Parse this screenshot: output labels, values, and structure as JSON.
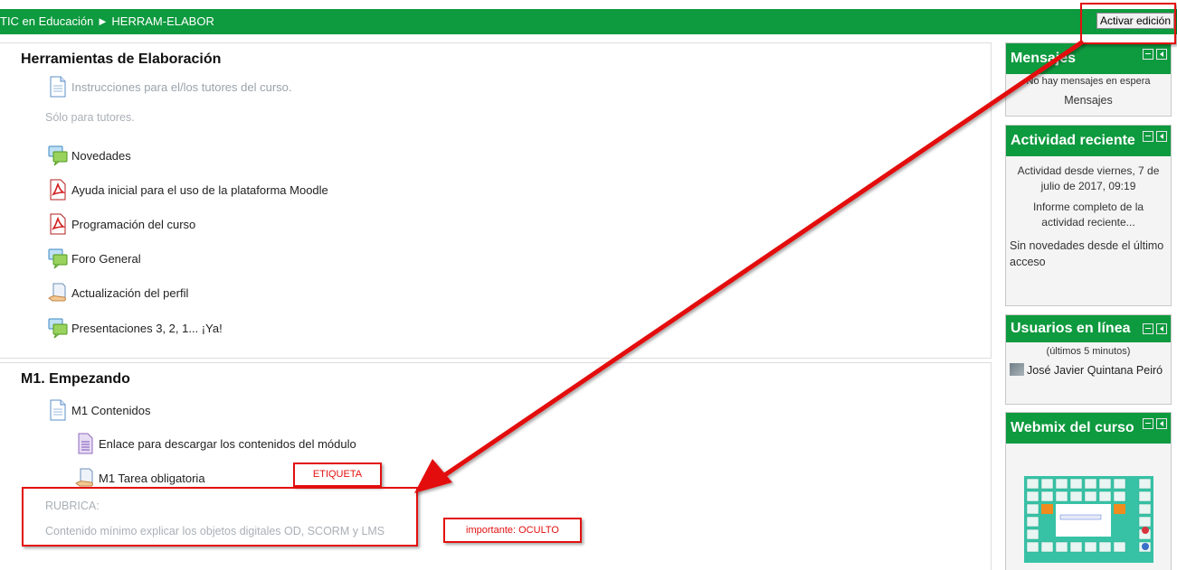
{
  "header": {
    "breadcrumb": "TIC en Educación ► HERRAM-ELABOR",
    "edit_button": "Activar edición"
  },
  "sections": [
    {
      "title": "Herramientas de Elaboración",
      "instr_link": "Instrucciones para el/los tutores del curso.",
      "instr_note": "Sólo para tutores.",
      "items": [
        {
          "label": "Novedades",
          "icon": "forum-icon"
        },
        {
          "label": "Ayuda inicial para el uso de la plataforma Moodle",
          "icon": "pdf-icon"
        },
        {
          "label": "Programación del curso",
          "icon": "pdf-icon"
        },
        {
          "label": "Foro General",
          "icon": "forum-icon"
        },
        {
          "label": "Actualización del perfil",
          "icon": "assignment-icon"
        },
        {
          "label": "Presentaciones 3, 2, 1... ¡Ya!",
          "icon": "forum-icon"
        }
      ]
    },
    {
      "title": "M1. Empezando",
      "items": [
        {
          "label": "M1 Contenidos",
          "icon": "page-icon"
        },
        {
          "label": "Enlace para descargar los contenidos del módulo",
          "icon": "file-icon"
        },
        {
          "label": "M1 Tarea obligatoria",
          "icon": "assignment-icon"
        }
      ],
      "label_title": "RUBRICA:",
      "label_text": "Contenido mínimo explicar los objetos digitales OD, SCORM y LMS"
    }
  ],
  "blocks": {
    "mensajes": {
      "title": "Mensajes",
      "text": "No hay mensajes en espera",
      "link": "Mensajes"
    },
    "actividad": {
      "title": "Actividad reciente",
      "since": "Actividad desde viernes, 7 de julio de 2017, 09:19",
      "report": "Informe completo de la actividad reciente...",
      "none": "Sin novedades desde el último acceso"
    },
    "usuarios": {
      "title": "Usuarios en línea",
      "window": "(últimos 5 minutos)",
      "user": "José Javier Quintana Peiró"
    },
    "webmix": {
      "title": "Webmix del curso"
    }
  },
  "annotations": {
    "etiqueta": "ETIQUETA",
    "oculto": "importante: OCULTO"
  },
  "colors": {
    "header": "#0e9a3f",
    "annotation": "#e3100f"
  }
}
